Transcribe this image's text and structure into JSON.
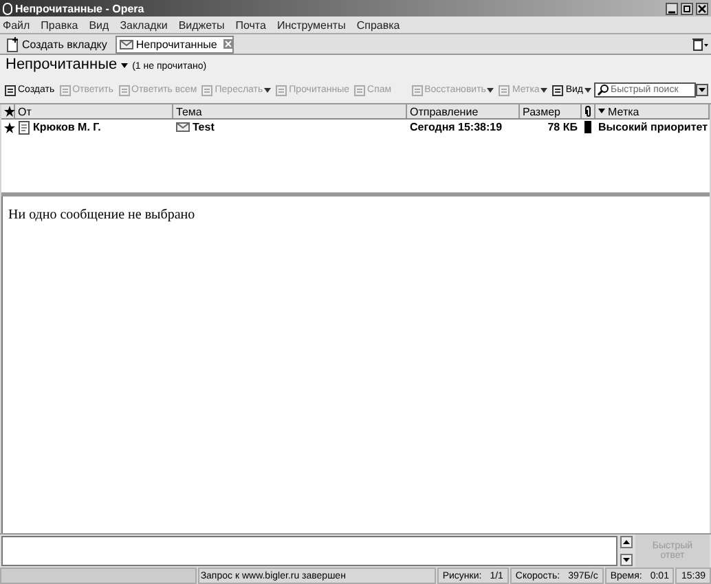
{
  "window": {
    "title": "Непрочитанные - Opera"
  },
  "menu": [
    "Файл",
    "Правка",
    "Вид",
    "Закладки",
    "Виджеты",
    "Почта",
    "Инструменты",
    "Справка"
  ],
  "tabs": [
    {
      "label": "Создать вкладку",
      "kind": "new",
      "selected": false
    },
    {
      "label": "Непрочитанные",
      "kind": "page",
      "selected": true
    }
  ],
  "view": {
    "title": "Непрочитанные",
    "count": "(1 не прочитано)"
  },
  "toolbar": {
    "left": [
      {
        "label": "Создать",
        "disabled": false,
        "dropdown": false
      },
      {
        "label": "Ответить",
        "disabled": true,
        "dropdown": false
      },
      {
        "label": "Ответить всем",
        "disabled": true,
        "dropdown": false
      },
      {
        "label": "Переслать",
        "disabled": true,
        "dropdown": true
      },
      {
        "label": "Прочитанные",
        "disabled": true,
        "dropdown": false
      },
      {
        "label": "Спам",
        "disabled": true,
        "dropdown": false
      }
    ],
    "right": [
      {
        "label": "Восстановить",
        "disabled": true,
        "dropdown": true
      },
      {
        "label": "Метка",
        "disabled": true,
        "dropdown": true
      },
      {
        "label": "Вид",
        "disabled": false,
        "dropdown": true
      }
    ]
  },
  "search": {
    "placeholder": "Быстрый поиск"
  },
  "table": {
    "columns": [
      "От",
      "Тема",
      "Отправление",
      "Размер",
      "Метка"
    ],
    "rows": [
      {
        "from": "Крюков М. Г.",
        "subject": "Test",
        "sent": "Сегодня 15:38:19",
        "size": "78 КБ",
        "label": "Высокий приоритет",
        "unread": true
      }
    ]
  },
  "preview": {
    "message": "Ни одно сообщение не выбрано"
  },
  "reply": {
    "button": "Быстрый ответ",
    "disabled": true
  },
  "status": {
    "message": "Запрос к www.bigler.ru завершен",
    "fields": [
      {
        "label": "Рисунки:",
        "value": "1/1"
      },
      {
        "label": "Скорость:",
        "value": "397Б/с"
      },
      {
        "label": "Время:",
        "value": "0:01"
      }
    ],
    "clock": "15:39"
  }
}
